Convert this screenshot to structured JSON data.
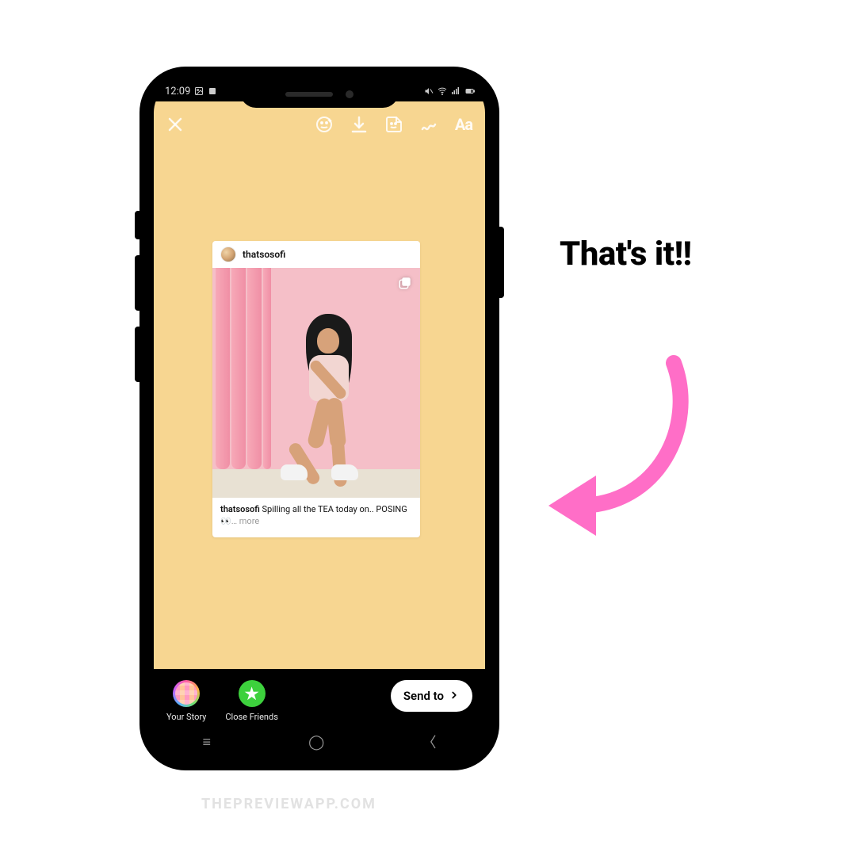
{
  "status": {
    "time": "12:09"
  },
  "toolbar": {
    "text_label": "Aa"
  },
  "post": {
    "username": "thatsosofi",
    "caption_user": "thatsosofi",
    "caption_text": " Spilling all the TEA today on.. POSING ",
    "caption_emoji": "👀",
    "more_label": "… more"
  },
  "bottom": {
    "your_story_label": "Your Story",
    "close_friends_label": "Close Friends",
    "send_label": "Send to"
  },
  "headline": "That's it!!",
  "watermark": "THEPREVIEWAPP.COM",
  "colors": {
    "story_bg": "#f7d691",
    "arrow": "#ff6ec7"
  }
}
